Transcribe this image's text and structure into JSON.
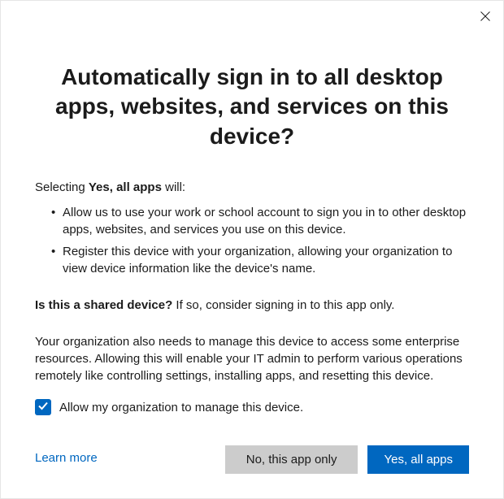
{
  "title": "Automatically sign in to all desktop apps, websites, and services on this device?",
  "intro": {
    "prefix": "Selecting ",
    "bold": "Yes, all apps",
    "suffix": " will:"
  },
  "bullets": [
    "Allow us to use your work or school account to sign you in to other desktop apps, websites, and services you use on this device.",
    "Register this device with your organization, allowing your organization to view device information like the device's name."
  ],
  "shared": {
    "bold": "Is this a shared device?",
    "rest": " If so, consider signing in to this app only."
  },
  "org_text": "Your organization also needs to manage this device to access some enterprise resources. Allowing this will enable your IT admin to perform various operations remotely like controlling settings, installing apps, and resetting this device.",
  "checkbox_label": "Allow my organization to manage this device.",
  "learn_more": "Learn more",
  "buttons": {
    "secondary": "No, this app only",
    "primary": "Yes, all apps"
  }
}
